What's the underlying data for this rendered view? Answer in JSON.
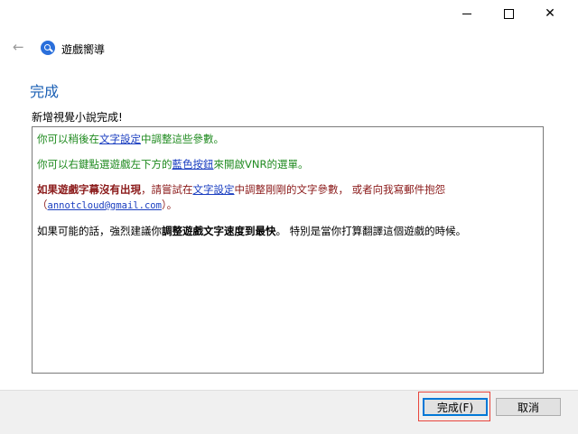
{
  "window": {
    "minimize_icon": "minimize-icon",
    "maximize_icon": "maximize-icon",
    "close_icon": "close-icon"
  },
  "header": {
    "back_icon": "back-arrow-icon",
    "app_icon": "search-magnifier-icon",
    "title": "遊戲嚮導"
  },
  "page": {
    "title": "完成",
    "subtitle": "新增視覺小說完成!"
  },
  "content": {
    "p1_prefix": "你可以稍後在",
    "p1_link": "文字設定",
    "p1_suffix": "中調整這些參數。",
    "p2_prefix": "你可以右鍵點選遊戲左下方的",
    "p2_link": "藍色按鈕",
    "p2_suffix": "來開啟VNR的選單。",
    "p3_bold": "如果遊戲字幕沒有出現",
    "p3_mid": "，請嘗試在",
    "p3_link": "文字設定",
    "p3_suffix": "中調整剛剛的文字參數， 或者向我寫郵件抱怨",
    "p3_email_open": "（",
    "p3_email": "annotcloud@gmail.com",
    "p3_email_close": "）。",
    "p4_prefix": "如果可能的話，強烈建議你",
    "p4_bold": "調整遊戲文字速度到最快",
    "p4_suffix": "。 特別是當你打算翻譯這個遊戲的時候。"
  },
  "buttons": {
    "finish": "完成(F)",
    "cancel": "取消"
  },
  "colors": {
    "accent": "#1a5fb4",
    "green_text": "#1e8a1e",
    "warning_text": "#8b1a1a",
    "link": "#1a3ec0",
    "highlight_border": "#e8453c"
  }
}
